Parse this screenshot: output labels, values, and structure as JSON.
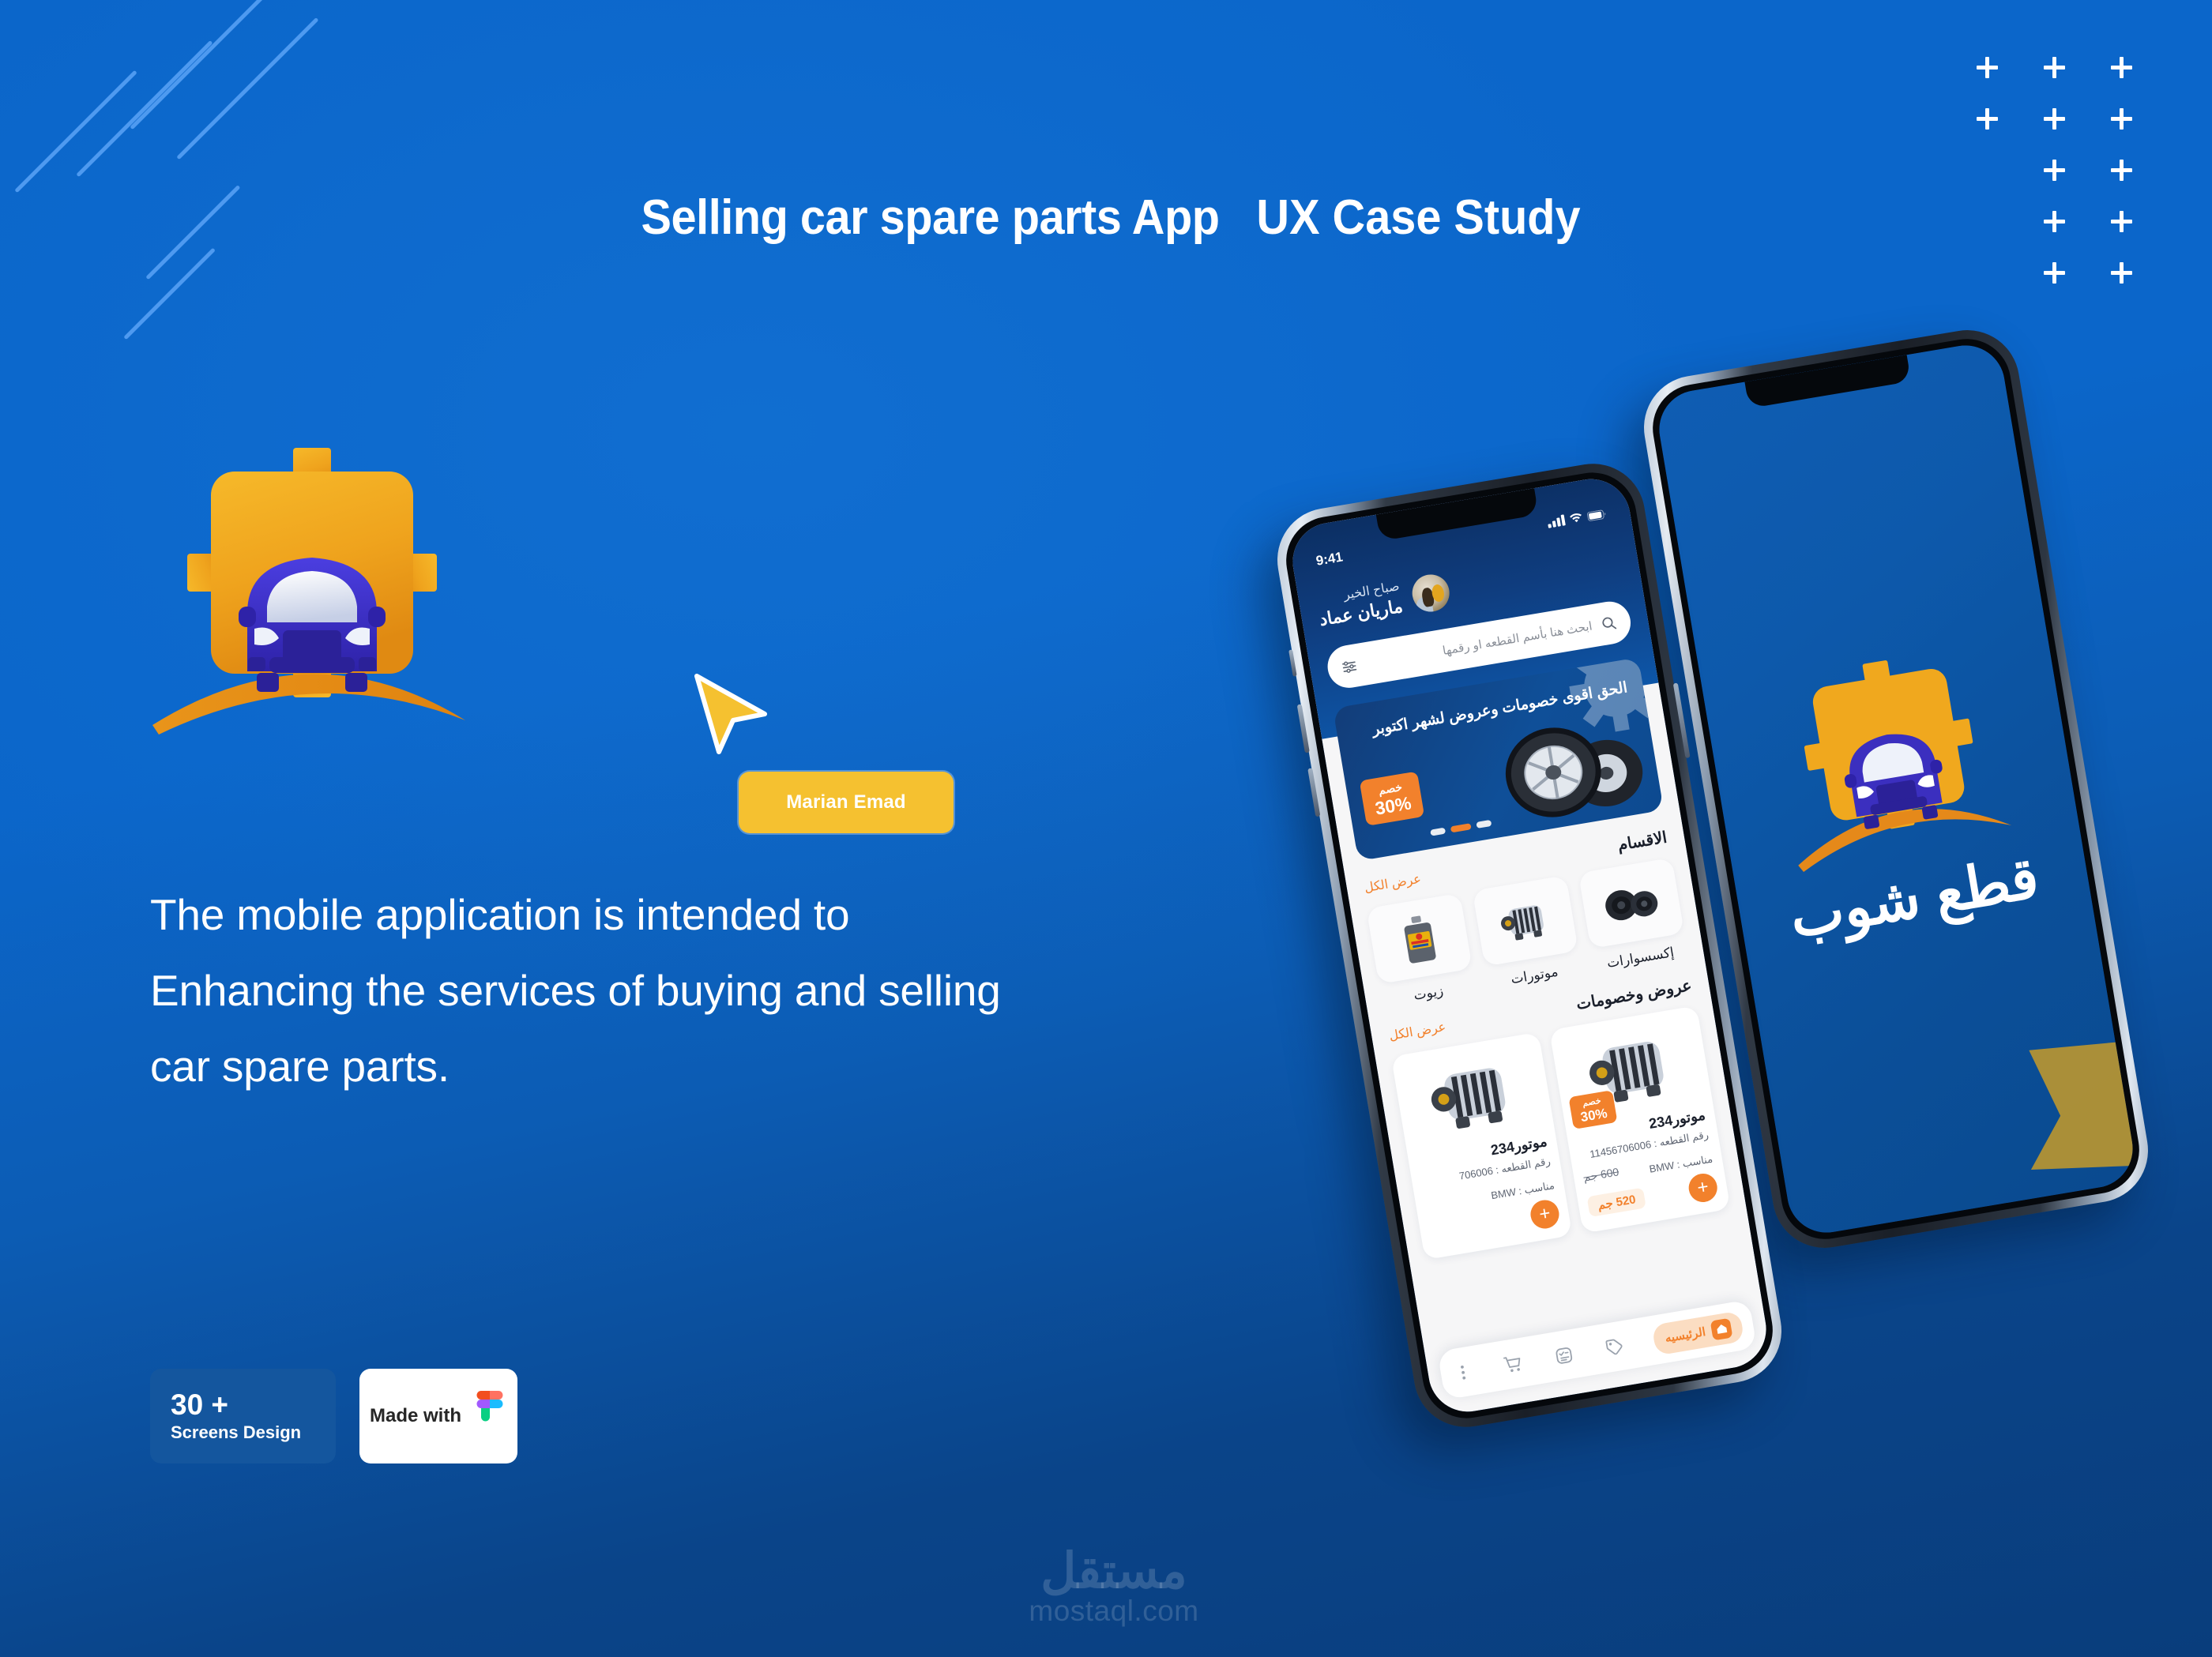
{
  "hero": {
    "title_line1": "Selling car spare parts  App",
    "title_line2": "UX Case Study",
    "author_button": "Marian Emad",
    "description": "The mobile application is intended to Enhancing the services of buying and selling car spare parts."
  },
  "badges": {
    "screens_count": "30 +",
    "screens_label": "Screens Design",
    "made_with": "Made with",
    "figma_icon": "figma-logo-icon"
  },
  "watermark": {
    "arabic": "مستقل",
    "domain": "mostaql.com"
  },
  "decor": {
    "stripes_icon": "diagonal-stripes-decoration",
    "plus_grid_icon": "plus-grid-decoration",
    "cursor_icon": "cursor-arrow-icon",
    "brand_logo_icon": "gear-car-logo-icon"
  },
  "colors": {
    "bg_top": "#0b66ca",
    "bg_bottom": "#093d7c",
    "accent_yellow": "#f5c130",
    "accent_orange": "#f2812c",
    "gear_gold": "#f0a81e",
    "car_purple": "#3b2fbf",
    "badge_blue": "#14569e"
  },
  "phone_back": {
    "screen": "splash",
    "logo_icon": "gear-car-logo-icon",
    "app_name": "قطع شوب"
  },
  "phone_front": {
    "status_bar": {
      "time": "9:41",
      "signal_icon": "cellular-signal-icon",
      "wifi_icon": "wifi-icon",
      "battery_icon": "battery-icon"
    },
    "header": {
      "greeting": "صباح الخير",
      "user_name": "ماريان عماد",
      "avatar_icon": "user-avatar",
      "search_placeholder": "ابحث هنا بأسم القطعه او رقمها",
      "search_icon": "search-icon",
      "filter_icon": "filter-sliders-icon"
    },
    "promo": {
      "title": "الحق اقوى خصومات وعروض لشهر اكتوبر",
      "discount_label": "خصم",
      "discount_value": "30%",
      "image_icon": "tires-image",
      "gear_icon": "gear-watermark-icon",
      "carousel_dots": 3,
      "active_dot": 1
    },
    "sections": [
      {
        "title": "الاقسام",
        "see_all": "عرض الكل",
        "items": [
          {
            "label": "إكسسوارات",
            "icon": "car-speakers-icon"
          },
          {
            "label": "موتورات",
            "icon": "alternator-icon"
          },
          {
            "label": "زيوت",
            "icon": "oil-bottle-icon"
          }
        ]
      },
      {
        "title": "عروض وخصومات",
        "see_all": "عرض الكل",
        "products": [
          {
            "name": "موتور234",
            "part_number": "رقم القطعه : 11456706006",
            "fits": "مناسب :  BMW",
            "old_price": "600 جم",
            "new_price": "520 جم",
            "discount_label": "خصم",
            "discount_value": "30%",
            "image_icon": "alternator-icon",
            "add_icon": "plus-icon"
          },
          {
            "name": "موتور234",
            "part_number": "رقم القطعه : 706006",
            "fits": "مناسب :  BMW",
            "old_price": "",
            "new_price": "",
            "discount_label": "",
            "discount_value": "",
            "image_icon": "alternator-icon",
            "add_icon": "plus-icon"
          }
        ]
      }
    ],
    "tabbar": {
      "home_label": "الرئيسيه",
      "home_icon": "home-icon",
      "items": [
        {
          "icon": "tag-icon"
        },
        {
          "icon": "list-check-icon"
        },
        {
          "icon": "cart-icon"
        },
        {
          "icon": "more-dots-icon"
        }
      ]
    }
  }
}
